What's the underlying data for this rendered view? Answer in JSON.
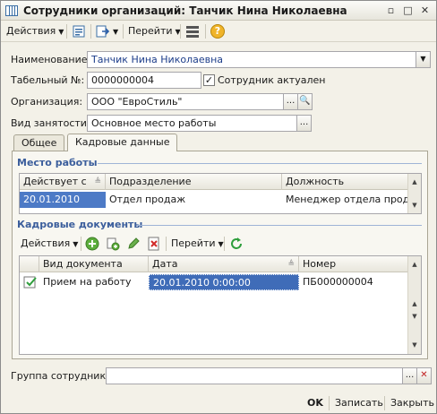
{
  "window": {
    "title": "Сотрудники организаций: Танчик Нина Николаевна",
    "controls": [
      "▫",
      "□",
      "✕"
    ]
  },
  "toolbar": {
    "actions_label": "Действия",
    "goto_label": "Перейти",
    "help_icon": "?"
  },
  "form": {
    "name_label": "Наименование:",
    "name_value": "Танчик Нина Николаевна",
    "tabnum_label": "Табельный №:",
    "tabnum_value": "0000000004",
    "active_label": "Сотрудник актуален",
    "active_checked": true,
    "org_label": "Организация:",
    "org_value": "ООО \"ЕвроСтиль\"",
    "employment_label": "Вид занятости:",
    "employment_value": "Основное место работы"
  },
  "tabs": [
    {
      "label": "Общее",
      "active": false
    },
    {
      "label": "Кадровые данные",
      "active": true
    }
  ],
  "workplace": {
    "title": "Место работы",
    "columns": [
      "Действует с",
      "Подразделение",
      "Должность"
    ],
    "rows": [
      [
        "20.01.2010",
        "Отдел продаж",
        "Менеджер отдела продаж"
      ]
    ]
  },
  "hr_docs": {
    "title": "Кадровые документы",
    "actions_label": "Действия",
    "goto_label": "Перейти",
    "columns": [
      "Вид документа",
      "Дата",
      "Номер"
    ],
    "rows": [
      [
        "Прием на работу",
        "20.01.2010 0:00:00",
        "ПБ000000004"
      ]
    ]
  },
  "group": {
    "label": "Группа сотрудника:",
    "value": ""
  },
  "footer": {
    "ok": "OK",
    "save": "Записать",
    "close": "Закрыть"
  }
}
